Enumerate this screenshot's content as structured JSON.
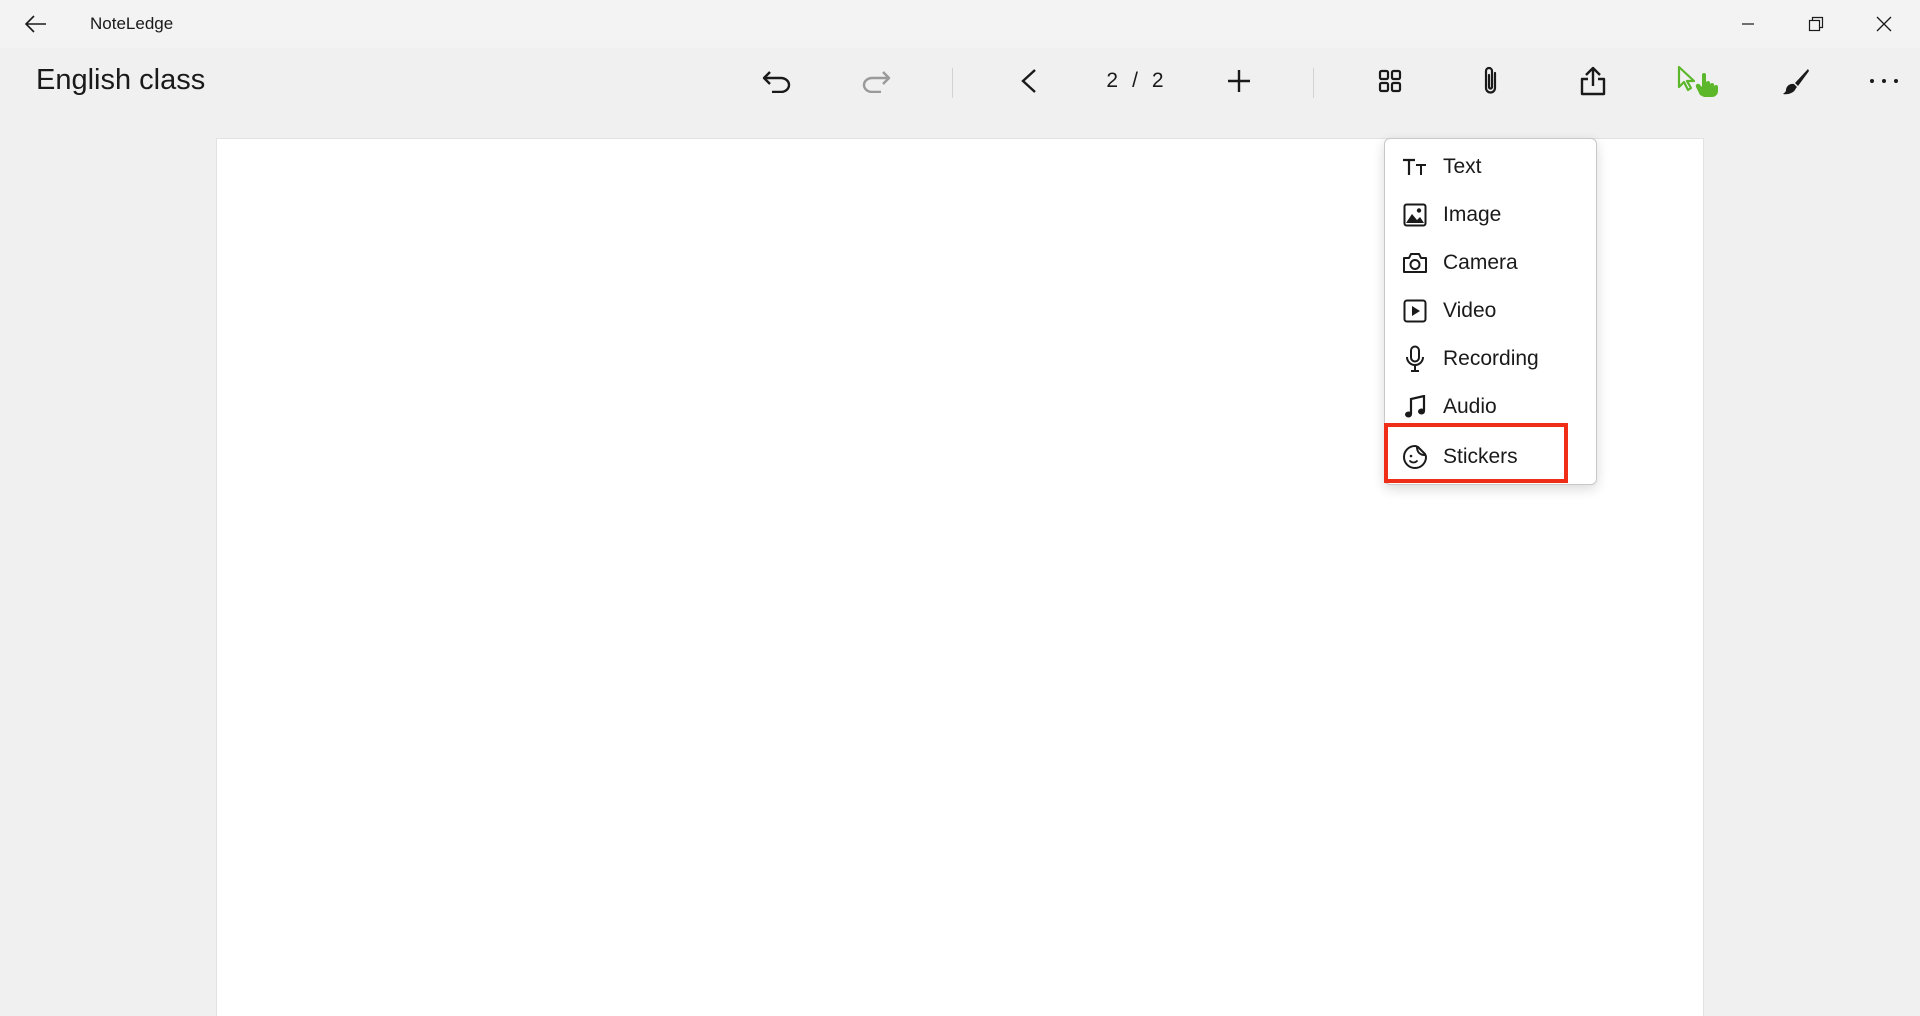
{
  "window": {
    "app_title": "NoteLedge"
  },
  "toolbar": {
    "document_title": "English class",
    "page_current": "2",
    "page_separator": "/",
    "page_total": "2",
    "select_tool_color": "#5cb82a"
  },
  "insert_menu": {
    "items": [
      {
        "label": "Text",
        "icon": "text-size-icon"
      },
      {
        "label": "Image",
        "icon": "image-icon"
      },
      {
        "label": "Camera",
        "icon": "camera-icon"
      },
      {
        "label": "Video",
        "icon": "video-icon"
      },
      {
        "label": "Recording",
        "icon": "microphone-icon"
      },
      {
        "label": "Audio",
        "icon": "music-note-icon"
      },
      {
        "label": "Stickers",
        "icon": "sticker-icon"
      }
    ],
    "highlighted_item": "Stickers",
    "highlight_color": "#f02d16"
  }
}
